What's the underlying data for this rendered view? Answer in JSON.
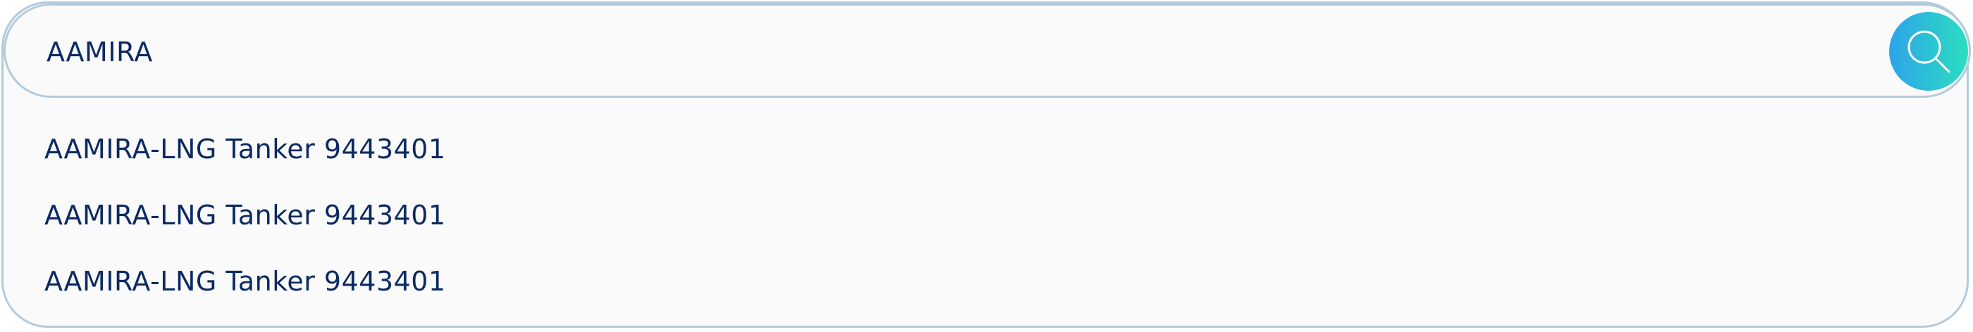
{
  "search": {
    "value": "AAMIRA",
    "button_icon": "search-icon"
  },
  "results": [
    "AAMIRA-LNG Tanker 9443401",
    "AAMIRA-LNG Tanker 9443401",
    "AAMIRA-LNG Tanker 9443401"
  ],
  "colors": {
    "text": "#0c2a63",
    "border": "#b3cadb",
    "background": "#fafafa",
    "button_gradient_start": "#2da4ea",
    "button_gradient_end": "#2cddc0"
  }
}
